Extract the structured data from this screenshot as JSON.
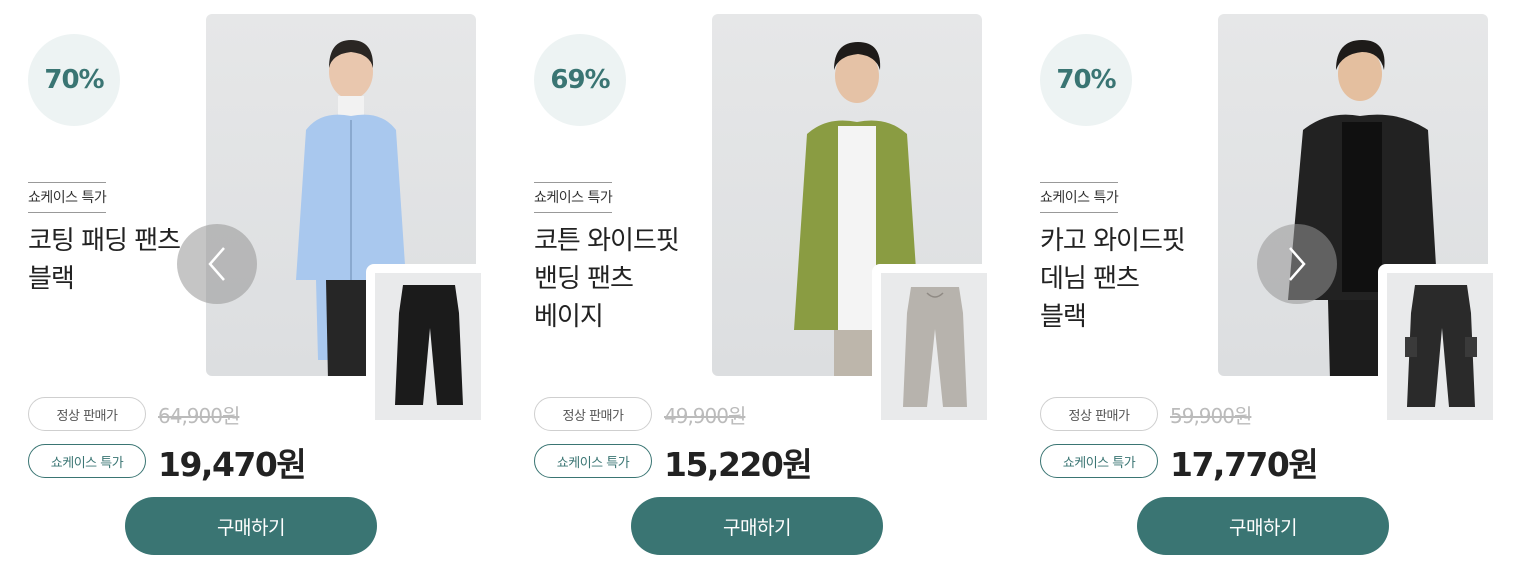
{
  "nav": {
    "prev_icon": "chevron-left-icon",
    "next_icon": "chevron-right-icon"
  },
  "colors": {
    "accent": "#3a7573",
    "discount_bg": "#edf3f3",
    "photo_bg": "#e3e4e5"
  },
  "products": [
    {
      "discount": "70%",
      "tag": "쇼케이스 특가",
      "name_lines": [
        "코팅 패딩 팬츠",
        "블랙"
      ],
      "regular_label": "정상 판매가",
      "regular_price": "64,900원",
      "special_label": "쇼케이스 특가",
      "sale_price": "19,470원",
      "buy_label": "구매하기",
      "model_icon": "woman-blue-cardigan-model-photo",
      "thumb_icon": "black-pants-thumbnail"
    },
    {
      "discount": "69%",
      "tag": "쇼케이스 특가",
      "name_lines": [
        "코튼 와이드핏",
        "밴딩 팬츠",
        "베이지"
      ],
      "regular_label": "정상 판매가",
      "regular_price": "49,900원",
      "special_label": "쇼케이스 특가",
      "sale_price": "15,220원",
      "buy_label": "구매하기",
      "model_icon": "man-green-cardigan-model-photo",
      "thumb_icon": "beige-pants-thumbnail"
    },
    {
      "discount": "70%",
      "tag": "쇼케이스 특가",
      "name_lines": [
        "카고 와이드핏",
        "데님 팬츠",
        "블랙"
      ],
      "regular_label": "정상 판매가",
      "regular_price": "59,900원",
      "special_label": "쇼케이스 특가",
      "sale_price": "17,770원",
      "buy_label": "구매하기",
      "model_icon": "man-leather-jacket-model-photo",
      "thumb_icon": "black-cargo-pants-thumbnail"
    }
  ]
}
